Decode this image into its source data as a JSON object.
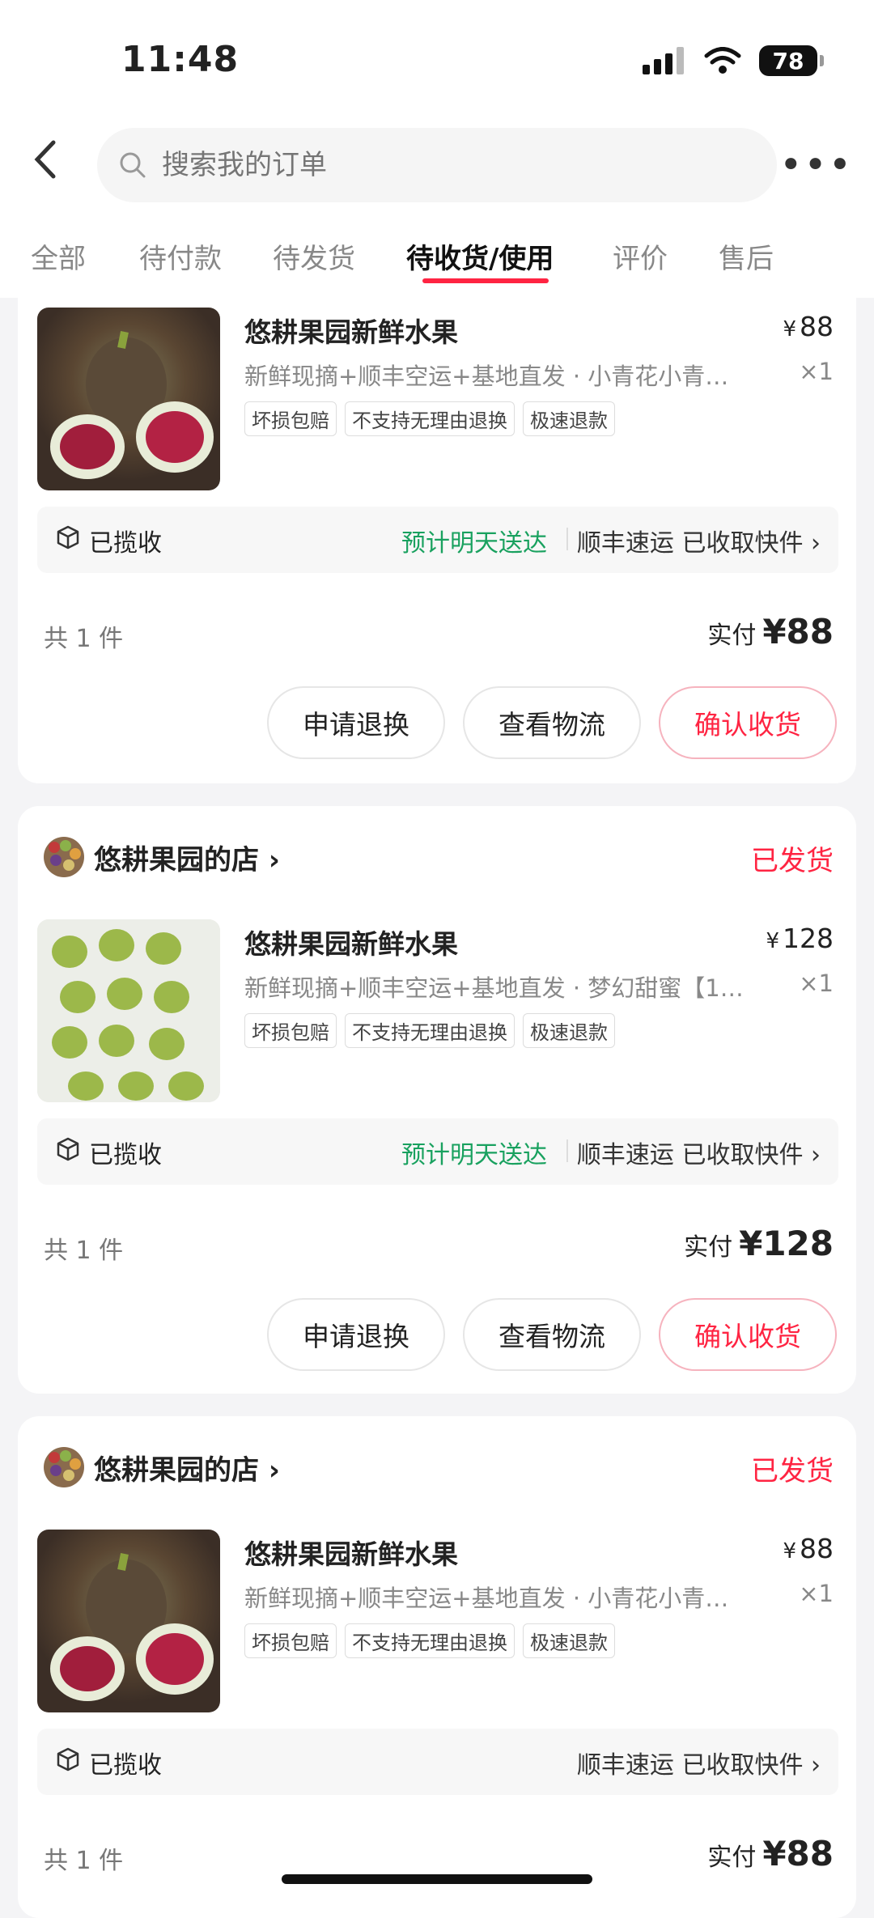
{
  "status_bar": {
    "time": "11:48",
    "battery": "78"
  },
  "search": {
    "placeholder": "搜索我的订单"
  },
  "tabs": [
    {
      "label": "全部"
    },
    {
      "label": "待付款"
    },
    {
      "label": "待发货"
    },
    {
      "label": "待收货/使用"
    },
    {
      "label": "评价"
    },
    {
      "label": "售后"
    }
  ],
  "colors": {
    "accent": "#ff2442",
    "eta_green": "#19a15f"
  },
  "orders": [
    {
      "product": "悠耕果园新鲜水果",
      "price_symbol": "¥",
      "price": "88",
      "desc": "新鲜现摘+顺丰空运+基地直发 · 小青花小青…",
      "qty": "×1",
      "tags": [
        "坏损包赔",
        "不支持无理由退换",
        "极速退款"
      ],
      "logistics_state": "已揽收",
      "eta": "预计明天送达",
      "carrier": "顺丰速运 已收取快件 ›",
      "count": "共 1 件",
      "paid_label": "实付",
      "paid_amount": "¥88",
      "buttons": [
        "申请退换",
        "查看物流",
        "确认收货"
      ]
    },
    {
      "shop": "悠耕果园的店 ›",
      "status": "已发货",
      "product": "悠耕果园新鲜水果",
      "price_symbol": "¥",
      "price": "128",
      "desc": "新鲜现摘+顺丰空运+基地直发 · 梦幻甜蜜【1…",
      "qty": "×1",
      "tags": [
        "坏损包赔",
        "不支持无理由退换",
        "极速退款"
      ],
      "logistics_state": "已揽收",
      "eta": "预计明天送达",
      "carrier": "顺丰速运 已收取快件 ›",
      "count": "共 1 件",
      "paid_label": "实付",
      "paid_amount": "¥128",
      "buttons": [
        "申请退换",
        "查看物流",
        "确认收货"
      ]
    },
    {
      "shop": "悠耕果园的店 ›",
      "status": "已发货",
      "product": "悠耕果园新鲜水果",
      "price_symbol": "¥",
      "price": "88",
      "desc": "新鲜现摘+顺丰空运+基地直发 · 小青花小青…",
      "qty": "×1",
      "tags": [
        "坏损包赔",
        "不支持无理由退换",
        "极速退款"
      ],
      "logistics_state": "已揽收",
      "carrier": "顺丰速运 已收取快件 ›",
      "count": "共 1 件",
      "paid_label": "实付",
      "paid_amount": "¥88"
    }
  ]
}
